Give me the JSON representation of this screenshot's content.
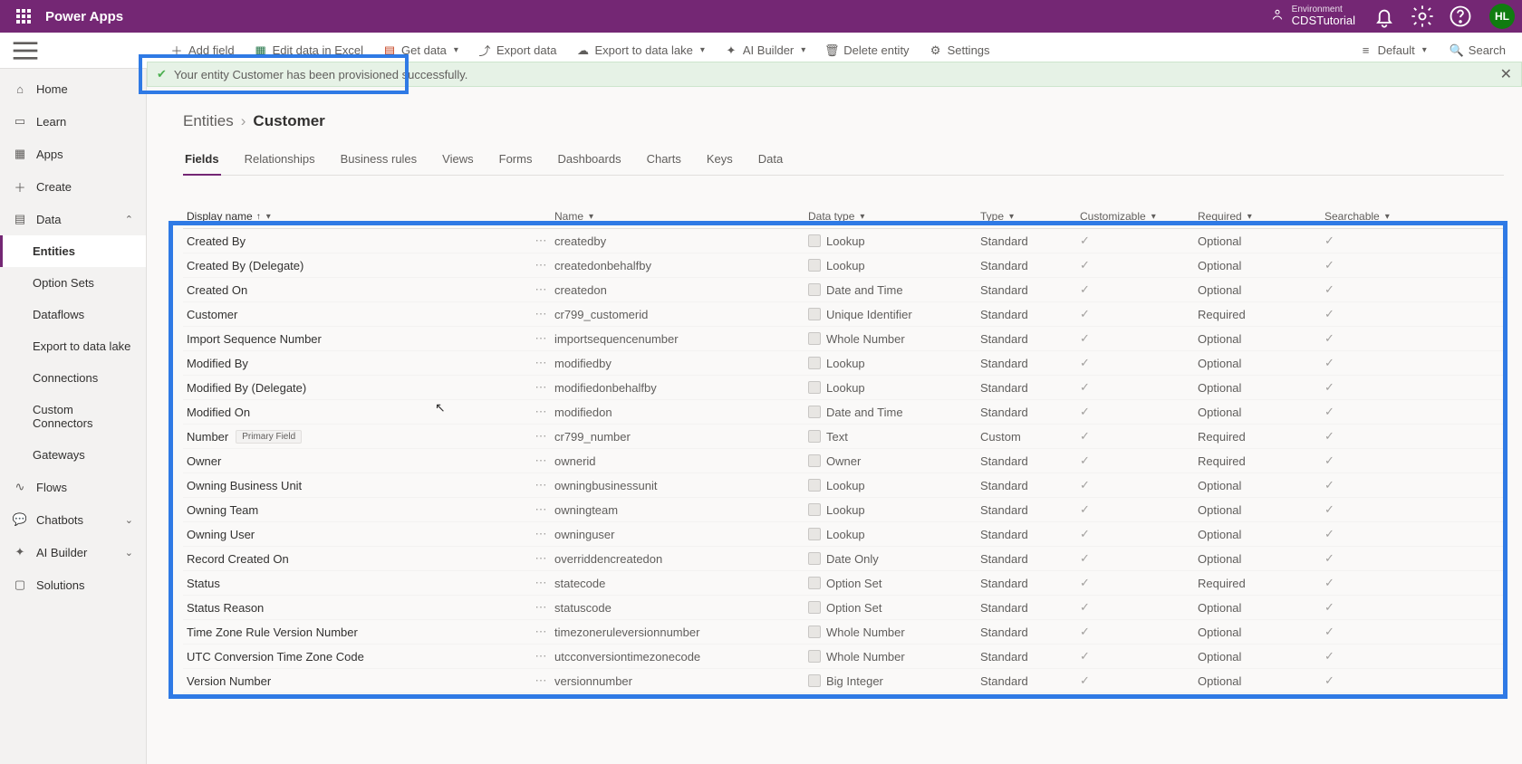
{
  "app_name": "Power Apps",
  "environment": {
    "label": "Environment",
    "name": "CDSTutorial"
  },
  "avatar_initials": "HL",
  "cmd": {
    "add_field": "Add field",
    "edit_excel": "Edit data in Excel",
    "get_data": "Get data",
    "export_data": "Export data",
    "export_lake": "Export to data lake",
    "ai_builder": "AI Builder",
    "delete_entity": "Delete entity",
    "settings": "Settings",
    "default_view": "Default",
    "search": "Search"
  },
  "notification": "Your entity Customer has been provisioned successfully.",
  "nav": {
    "home": "Home",
    "learn": "Learn",
    "apps": "Apps",
    "create": "Create",
    "data": "Data",
    "entities": "Entities",
    "option_sets": "Option Sets",
    "dataflows": "Dataflows",
    "export_lake": "Export to data lake",
    "connections": "Connections",
    "custom_conn": "Custom Connectors",
    "gateways": "Gateways",
    "flows": "Flows",
    "chatbots": "Chatbots",
    "ai_builder": "AI Builder",
    "solutions": "Solutions"
  },
  "breadcrumb": {
    "root": "Entities",
    "leaf": "Customer"
  },
  "tabs": [
    "Fields",
    "Relationships",
    "Business rules",
    "Views",
    "Forms",
    "Dashboards",
    "Charts",
    "Keys",
    "Data"
  ],
  "active_tab": "Fields",
  "columns": {
    "display": "Display name",
    "name": "Name",
    "datatype": "Data type",
    "type": "Type",
    "customizable": "Customizable",
    "required": "Required",
    "searchable": "Searchable"
  },
  "primary_badge": "Primary Field",
  "rows": [
    {
      "display": "Created By",
      "name": "createdby",
      "datatype": "Lookup",
      "type": "Standard",
      "required": "Optional"
    },
    {
      "display": "Created By (Delegate)",
      "name": "createdonbehalfby",
      "datatype": "Lookup",
      "type": "Standard",
      "required": "Optional"
    },
    {
      "display": "Created On",
      "name": "createdon",
      "datatype": "Date and Time",
      "type": "Standard",
      "required": "Optional"
    },
    {
      "display": "Customer",
      "name": "cr799_customerid",
      "datatype": "Unique Identifier",
      "type": "Standard",
      "required": "Required"
    },
    {
      "display": "Import Sequence Number",
      "name": "importsequencenumber",
      "datatype": "Whole Number",
      "type": "Standard",
      "required": "Optional"
    },
    {
      "display": "Modified By",
      "name": "modifiedby",
      "datatype": "Lookup",
      "type": "Standard",
      "required": "Optional"
    },
    {
      "display": "Modified By (Delegate)",
      "name": "modifiedonbehalfby",
      "datatype": "Lookup",
      "type": "Standard",
      "required": "Optional"
    },
    {
      "display": "Modified On",
      "name": "modifiedon",
      "datatype": "Date and Time",
      "type": "Standard",
      "required": "Optional"
    },
    {
      "display": "Number",
      "name": "cr799_number",
      "datatype": "Text",
      "type": "Custom",
      "required": "Required",
      "primary": true
    },
    {
      "display": "Owner",
      "name": "ownerid",
      "datatype": "Owner",
      "type": "Standard",
      "required": "Required"
    },
    {
      "display": "Owning Business Unit",
      "name": "owningbusinessunit",
      "datatype": "Lookup",
      "type": "Standard",
      "required": "Optional"
    },
    {
      "display": "Owning Team",
      "name": "owningteam",
      "datatype": "Lookup",
      "type": "Standard",
      "required": "Optional"
    },
    {
      "display": "Owning User",
      "name": "owninguser",
      "datatype": "Lookup",
      "type": "Standard",
      "required": "Optional"
    },
    {
      "display": "Record Created On",
      "name": "overriddencreatedon",
      "datatype": "Date Only",
      "type": "Standard",
      "required": "Optional"
    },
    {
      "display": "Status",
      "name": "statecode",
      "datatype": "Option Set",
      "type": "Standard",
      "required": "Required"
    },
    {
      "display": "Status Reason",
      "name": "statuscode",
      "datatype": "Option Set",
      "type": "Standard",
      "required": "Optional"
    },
    {
      "display": "Time Zone Rule Version Number",
      "name": "timezoneruleversionnumber",
      "datatype": "Whole Number",
      "type": "Standard",
      "required": "Optional"
    },
    {
      "display": "UTC Conversion Time Zone Code",
      "name": "utcconversiontimezonecode",
      "datatype": "Whole Number",
      "type": "Standard",
      "required": "Optional"
    },
    {
      "display": "Version Number",
      "name": "versionnumber",
      "datatype": "Big Integer",
      "type": "Standard",
      "required": "Optional"
    }
  ]
}
